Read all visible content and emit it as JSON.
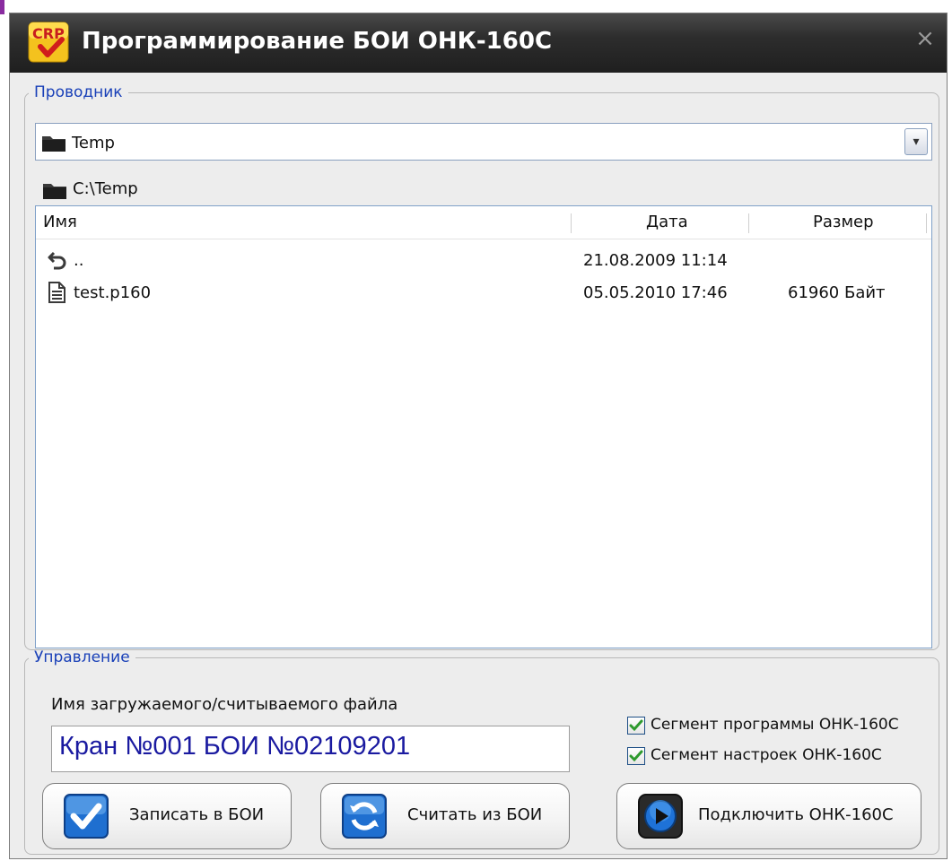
{
  "window": {
    "title": "Программирование БОИ ОНК-160С",
    "icon_text": "CRP",
    "close_glyph": "×"
  },
  "explorer": {
    "group_label": "Проводник",
    "folder_combo": {
      "value": "Temp",
      "arrow_glyph": "▾"
    },
    "current_path": "C:\\Temp",
    "columns": [
      "Имя",
      "Дата",
      "Размер"
    ],
    "rows": [
      {
        "icon": "up-folder-icon",
        "name": "..",
        "date": "21.08.2009 11:14",
        "size": ""
      },
      {
        "icon": "file-icon",
        "name": "test.p160",
        "date": "05.05.2010 17:46",
        "size": "61960 Байт"
      }
    ]
  },
  "control": {
    "group_label": "Управление",
    "filename_label": "Имя загружаемого/считываемого файла",
    "filename_value": "Кран №001 БОИ №02109201",
    "checkboxes": [
      {
        "label": "Сегмент программы ОНК-160С",
        "checked": true
      },
      {
        "label": "Сегмент настроек ОНК-160С",
        "checked": true
      }
    ],
    "buttons": {
      "write": "Записать в БОИ",
      "read": "Считать из БОИ",
      "connect": "Подключить ОНК-160С"
    }
  },
  "colors": {
    "titlebar": "#2d2d2d",
    "group_label": "#1940b8",
    "filename_text": "#1a1aa0",
    "list_border": "#7fa0c8",
    "checkmark": "#2e9a2e"
  }
}
